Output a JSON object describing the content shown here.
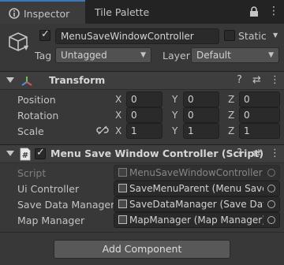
{
  "tabs": {
    "inspector": "Inspector",
    "tile_palette": "Tile Palette"
  },
  "header": {
    "object_name": "MenuSaveWindowController",
    "static_label": "Static",
    "tag_label": "Tag",
    "tag_value": "Untagged",
    "layer_label": "Layer",
    "layer_value": "Default"
  },
  "transform": {
    "title": "Transform",
    "rows": [
      {
        "label": "Position",
        "x": "0",
        "y": "0",
        "z": "0"
      },
      {
        "label": "Rotation",
        "x": "0",
        "y": "0",
        "z": "0"
      },
      {
        "label": "Scale",
        "x": "1",
        "y": "1",
        "z": "1"
      }
    ],
    "axes": {
      "x": "X",
      "y": "Y",
      "z": "Z"
    }
  },
  "script_component": {
    "title": "Menu Save Window Controller (Script)",
    "fields": [
      {
        "label": "Script",
        "value": "MenuSaveWindowController"
      },
      {
        "label": "Ui Controller",
        "value": "SaveMenuParent (Menu Save U"
      },
      {
        "label": "Save Data Manager",
        "value": "SaveDataManager (Save Data M"
      },
      {
        "label": "Map Manager",
        "value": "MapManager (Map Manager)"
      }
    ]
  },
  "add_component": "Add Component",
  "icons": [
    "inspector-icon",
    "lock-icon",
    "menu-icon",
    "cube-icon",
    "transform-axes-icon",
    "help-icon",
    "preset-icon",
    "more-icon",
    "script-icon",
    "link-icon",
    "object-picker-icon"
  ]
}
